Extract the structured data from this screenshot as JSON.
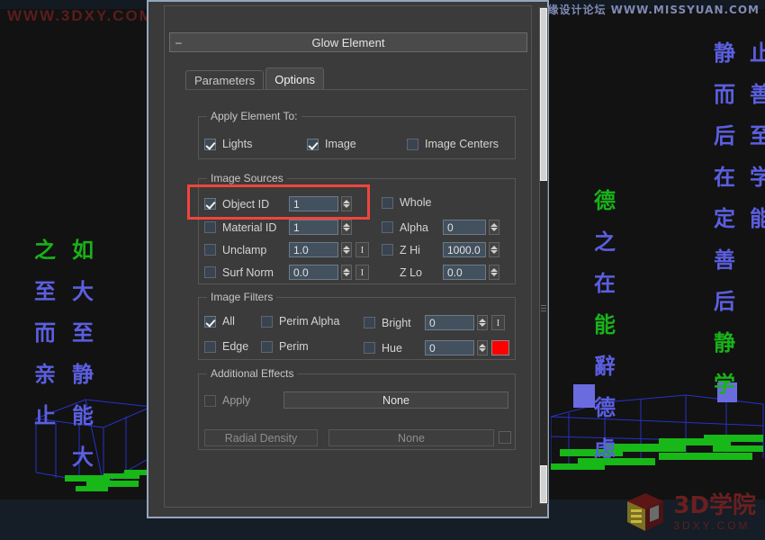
{
  "window": {
    "app": "3ds Max Render Effects",
    "rollout_title": "Glow Element",
    "collapse_glyph": "–"
  },
  "watermarks": {
    "top_left": "WWW.3DXY.COM",
    "top_right": "思缘设计论坛 WWW.MISSYUAN.COM",
    "bottom_right_line1": "3D学院",
    "bottom_right_line2": "3DXY.COM"
  },
  "viewport": {
    "column_a": [
      "如",
      "大",
      "至",
      "静",
      "能",
      "大"
    ],
    "column_b": [
      "之",
      "至",
      "而",
      "亲",
      "止"
    ],
    "column_c": [
      "德",
      "之",
      "在",
      "能",
      "辭",
      "德",
      "虑"
    ],
    "column_d": [
      "静",
      "而",
      "后",
      "在",
      "定",
      "善",
      "后",
      "静",
      "学"
    ],
    "column_e": [
      "止",
      "善",
      "至",
      "学",
      "能"
    ]
  },
  "tabs": [
    {
      "label": "Parameters",
      "active": false
    },
    {
      "label": "Options",
      "active": true
    }
  ],
  "apply_element_to": {
    "title": "Apply Element To:",
    "items": [
      {
        "label": "Lights",
        "checked": true
      },
      {
        "label": "Image",
        "checked": true
      },
      {
        "label": "Image Centers",
        "checked": false
      }
    ]
  },
  "image_sources": {
    "title": "Image Sources",
    "left_rows": [
      {
        "label": "Object ID",
        "checked": true,
        "value": "1",
        "spinner": true,
        "ibtn": false,
        "enabled": true
      },
      {
        "label": "Material ID",
        "checked": false,
        "value": "1",
        "spinner": true,
        "ibtn": false,
        "enabled": true
      },
      {
        "label": "Unclamp",
        "checked": false,
        "value": "1.0",
        "spinner": true,
        "ibtn": true,
        "enabled": true
      },
      {
        "label": "Surf Norm",
        "checked": false,
        "value": "0.0",
        "spinner": true,
        "ibtn": true,
        "enabled": true
      }
    ],
    "right_rows": [
      {
        "label": "Whole",
        "checked": false,
        "value": null,
        "spinner": false,
        "has_checkbox": true
      },
      {
        "label": "Alpha",
        "checked": false,
        "value": "0",
        "spinner": true,
        "has_checkbox": true
      },
      {
        "label": "Z Hi",
        "checked": false,
        "value": "1000.0",
        "spinner": true,
        "has_checkbox": true
      },
      {
        "label": "Z Lo",
        "checked": false,
        "value": "0.0",
        "spinner": true,
        "has_checkbox": false
      }
    ]
  },
  "image_filters": {
    "title": "Image Filters",
    "col1": [
      {
        "label": "All",
        "checked": true
      },
      {
        "label": "Edge",
        "checked": false
      }
    ],
    "col2": [
      {
        "label": "Perim Alpha",
        "checked": false
      },
      {
        "label": "Perim",
        "checked": false
      }
    ],
    "col3": [
      {
        "label": "Bright",
        "checked": false,
        "value": "0",
        "ibtn_label": "I",
        "has_ibtn": true,
        "has_swatch": false
      },
      {
        "label": "Hue",
        "checked": false,
        "value": "0",
        "ibtn_label": "",
        "has_ibtn": false,
        "has_swatch": true
      }
    ],
    "swatch_color": "#FF0000"
  },
  "additional_effects": {
    "title": "Additional Effects",
    "apply_label": "Apply",
    "apply_checked": false,
    "apply_enabled": false,
    "effect_button": "None",
    "radial_density_button": "Radial Density",
    "radial_density_value": "None",
    "radial_density_enabled": false
  },
  "colors": {
    "highlight": "#F0453C",
    "panel_bg": "#3B3B3B",
    "field_bg": "#43505E",
    "accent_red": "#FF0000"
  }
}
